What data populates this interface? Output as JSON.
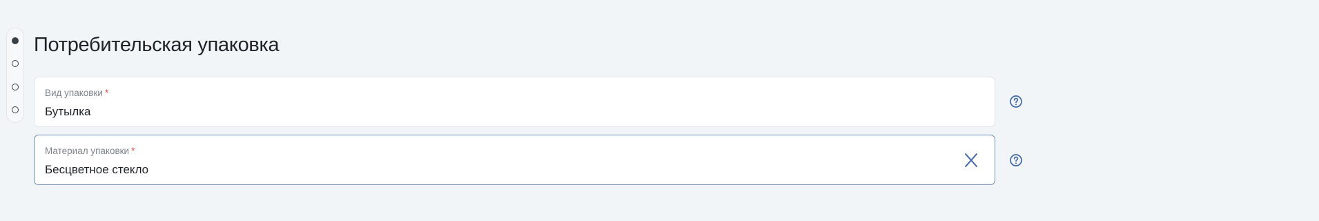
{
  "stepper": {
    "steps": [
      {
        "state": "active"
      },
      {
        "state": "inactive"
      },
      {
        "state": "inactive"
      },
      {
        "state": "inactive"
      }
    ]
  },
  "section": {
    "title": "Потребительская упаковка"
  },
  "fields": [
    {
      "label": "Вид упаковки",
      "required_mark": "*",
      "value": "Бутылка",
      "focused": false,
      "help_icon": "question-circle-icon"
    },
    {
      "label": "Материал упаковки",
      "required_mark": "*",
      "value": "Бесцветное стекло",
      "focused": true,
      "clear_icon": "close-icon",
      "help_icon": "question-circle-icon"
    }
  ],
  "colors": {
    "background": "#f2f5f8",
    "accent": "#3f66a8",
    "required": "#e5484d",
    "focused_border": "#6f8ab7"
  }
}
